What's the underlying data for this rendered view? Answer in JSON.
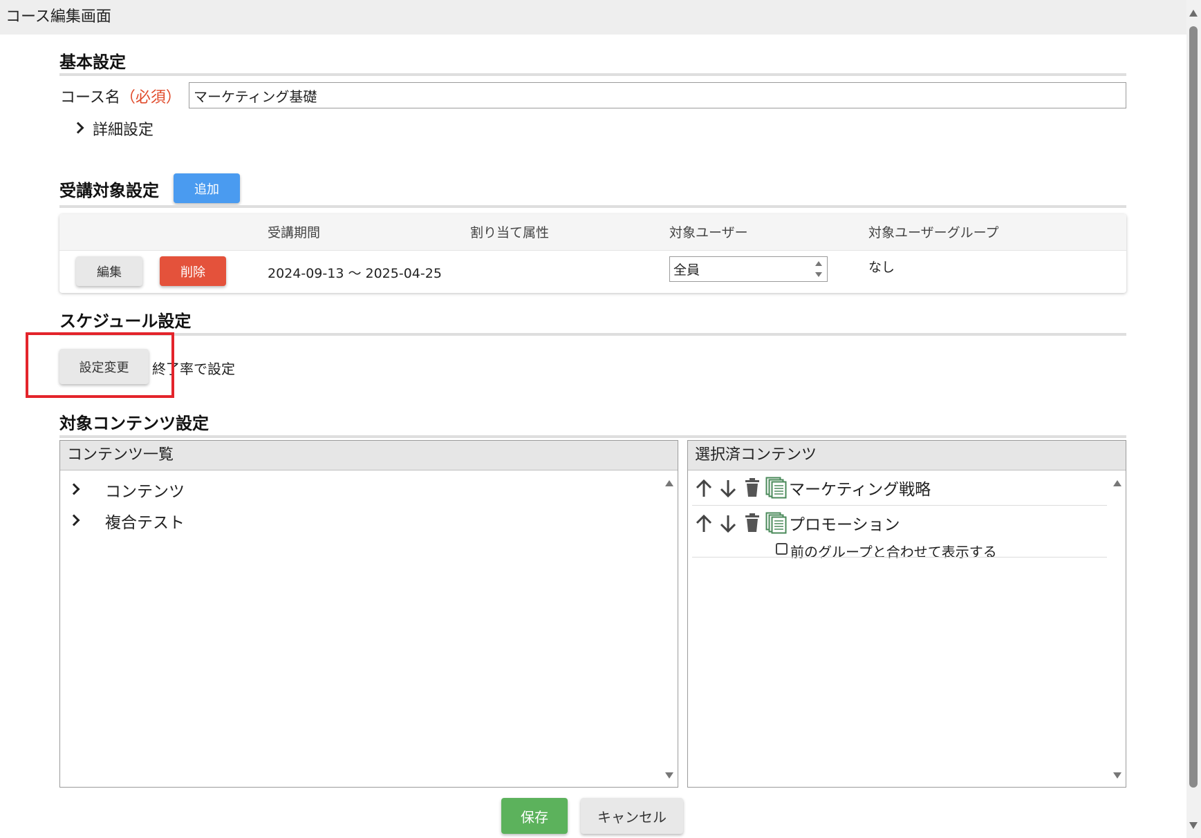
{
  "window": {
    "title": "コース編集画面"
  },
  "basic": {
    "title": "基本設定",
    "course_name_label": "コース名",
    "required_label": "（必須）",
    "course_name_value": "マーケティング基礎",
    "details_label": "詳細設定"
  },
  "target": {
    "title": "受講対象設定",
    "add_label": "追加",
    "columns": [
      "受講期間",
      "割り当て属性",
      "対象ユーザー",
      "対象ユーザーグループ"
    ],
    "rows": [
      {
        "edit_label": "編集",
        "delete_label": "削除",
        "period": "2024-09-13 ～ 2025-04-25",
        "attribute": "",
        "users": "全員",
        "user_groups": "なし"
      }
    ]
  },
  "schedule": {
    "title": "スケジュール設定",
    "change_label": "設定変更",
    "mode_text": "終了率で設定"
  },
  "content": {
    "title": "対象コンテンツ設定",
    "list_header": "コンテンツ一覧",
    "list_items": [
      "コンテンツ",
      "複合テスト"
    ],
    "selected_header": "選択済コンテンツ",
    "selected_items": [
      {
        "title": "マーケティング戦略"
      },
      {
        "title": "プロモーション",
        "checkbox_label": "前のグループと合わせて表示する"
      }
    ]
  },
  "footer": {
    "save_label": "保存",
    "cancel_label": "キャンセル"
  },
  "colors": {
    "primary": "#4a9bf0",
    "danger": "#e4523b",
    "success": "#5cb25c",
    "highlight": "#e3242b",
    "required": "#e04a2a"
  }
}
